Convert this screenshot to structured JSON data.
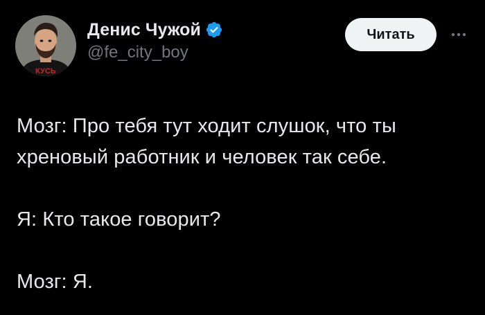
{
  "author": {
    "display_name": "Денис Чужой",
    "handle": "@fe_city_boy",
    "avatar_caption": "КУСЬ",
    "verified": true
  },
  "actions": {
    "follow_label": "Читать",
    "more_icon": "more-dots-icon"
  },
  "tweet": {
    "paragraphs": [
      "Мозг: Про тебя тут ходит слушок, что ты\nхреновый работник и человек так себе.",
      "Я: Кто такое говорит?",
      "Мозг: Я."
    ]
  },
  "colors": {
    "background": "#000000",
    "text": "#e7e9ea",
    "muted": "#71767b",
    "verified": "#1d9bf0",
    "button_bg": "#eff3f4"
  }
}
